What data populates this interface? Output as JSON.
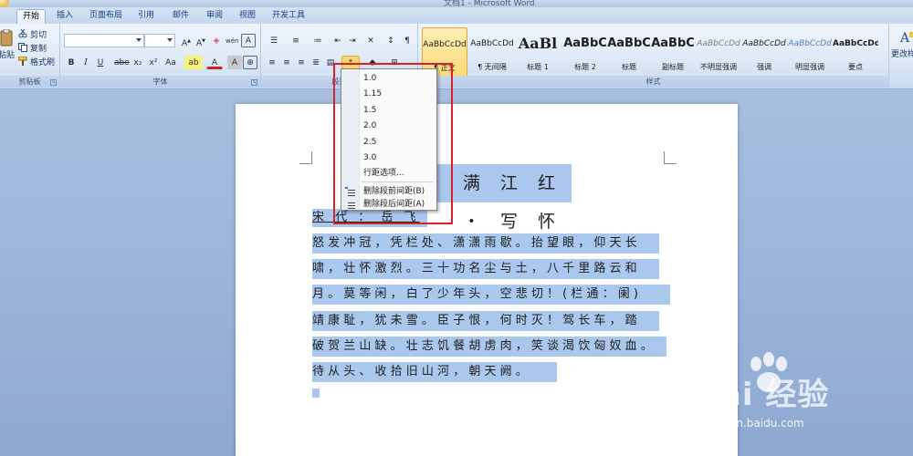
{
  "window": {
    "title": "文档1 - Microsoft Word"
  },
  "tabs": [
    "开始",
    "插入",
    "页面布局",
    "引用",
    "邮件",
    "审阅",
    "视图",
    "开发工具"
  ],
  "clipboard": {
    "cut": "剪切",
    "copy": "复制",
    "format_painter": "格式刷",
    "paste": "粘贴",
    "group_label": "剪贴板"
  },
  "font": {
    "group_label": "字体",
    "bold": "B",
    "italic": "I",
    "underline": "U",
    "strike": "abe",
    "subscript": "x₂",
    "superscript": "x²",
    "change_case": "Aa",
    "grow": "A",
    "shrink": "A",
    "clear": "A",
    "phonetic": "wén",
    "border": "A",
    "color_a": "A",
    "highlight": "ab",
    "shading": "A"
  },
  "paragraph": {
    "group_label": "段落"
  },
  "styles": {
    "group_label": "样式",
    "items": [
      {
        "sample": "AaBbCcDd",
        "name": "¶ 正文"
      },
      {
        "sample": "AaBbCcDd",
        "name": "¶ 无间隔"
      },
      {
        "sample": "AaBl",
        "name": "标题 1"
      },
      {
        "sample": "AaBbC",
        "name": "标题 2"
      },
      {
        "sample": "AaBbC",
        "name": "标题"
      },
      {
        "sample": "AaBbC",
        "name": "副标题"
      },
      {
        "sample": "AaBbCcDd",
        "name": "不明显强调"
      },
      {
        "sample": "AaBbCcDd",
        "name": "强调"
      },
      {
        "sample": "AaBbCcDd",
        "name": "明显强调"
      },
      {
        "sample": "AaBbCcDd",
        "name": "要点"
      }
    ],
    "change_styles": "更改样式"
  },
  "line_spacing_menu": {
    "options": [
      "1.0",
      "1.15",
      "1.5",
      "2.0",
      "2.5",
      "3.0"
    ],
    "more_options": "行距选项...",
    "remove_before": "删除段前间距(B)",
    "remove_after": "删除段后间距(A)"
  },
  "document": {
    "title": "满 江 红 ・ 写 怀",
    "author": "宋 代 ： 岳 飞",
    "lines": [
      "怒 发 冲 冠 ， 凭 栏 处 、 潇 潇 雨 歇 。 抬 望 眼 ， 仰 天 长",
      "啸 ， 壮 怀 激 烈 。 三 十 功 名 尘 与 土 ， 八 千 里 路 云 和",
      "月 。 莫 等 闲 ， 白 了 少 年 头 ， 空 悲 切 ！ ( 栏   通 ： 阑 )",
      "靖 康 耻 ， 犹 未 雪 。 臣 子 恨 ， 何 时 灭 ！ 驾 长 车 ， 踏",
      "破 贺 兰 山 缺 。 壮 志 饥 餐 胡 虏 肉 ， 笑 谈 渴 饮 匈 奴 血 。",
      "待 从 头 、 收 拾 旧 山 河 ， 朝 天 阙 。"
    ]
  },
  "watermark": {
    "logo": "Bai 经验",
    "url": "jingyan.baidu.com"
  },
  "colors": {
    "highlight_frame": "#d9202c",
    "selection": "#aac7ee",
    "ribbon_text": "#15428b"
  }
}
